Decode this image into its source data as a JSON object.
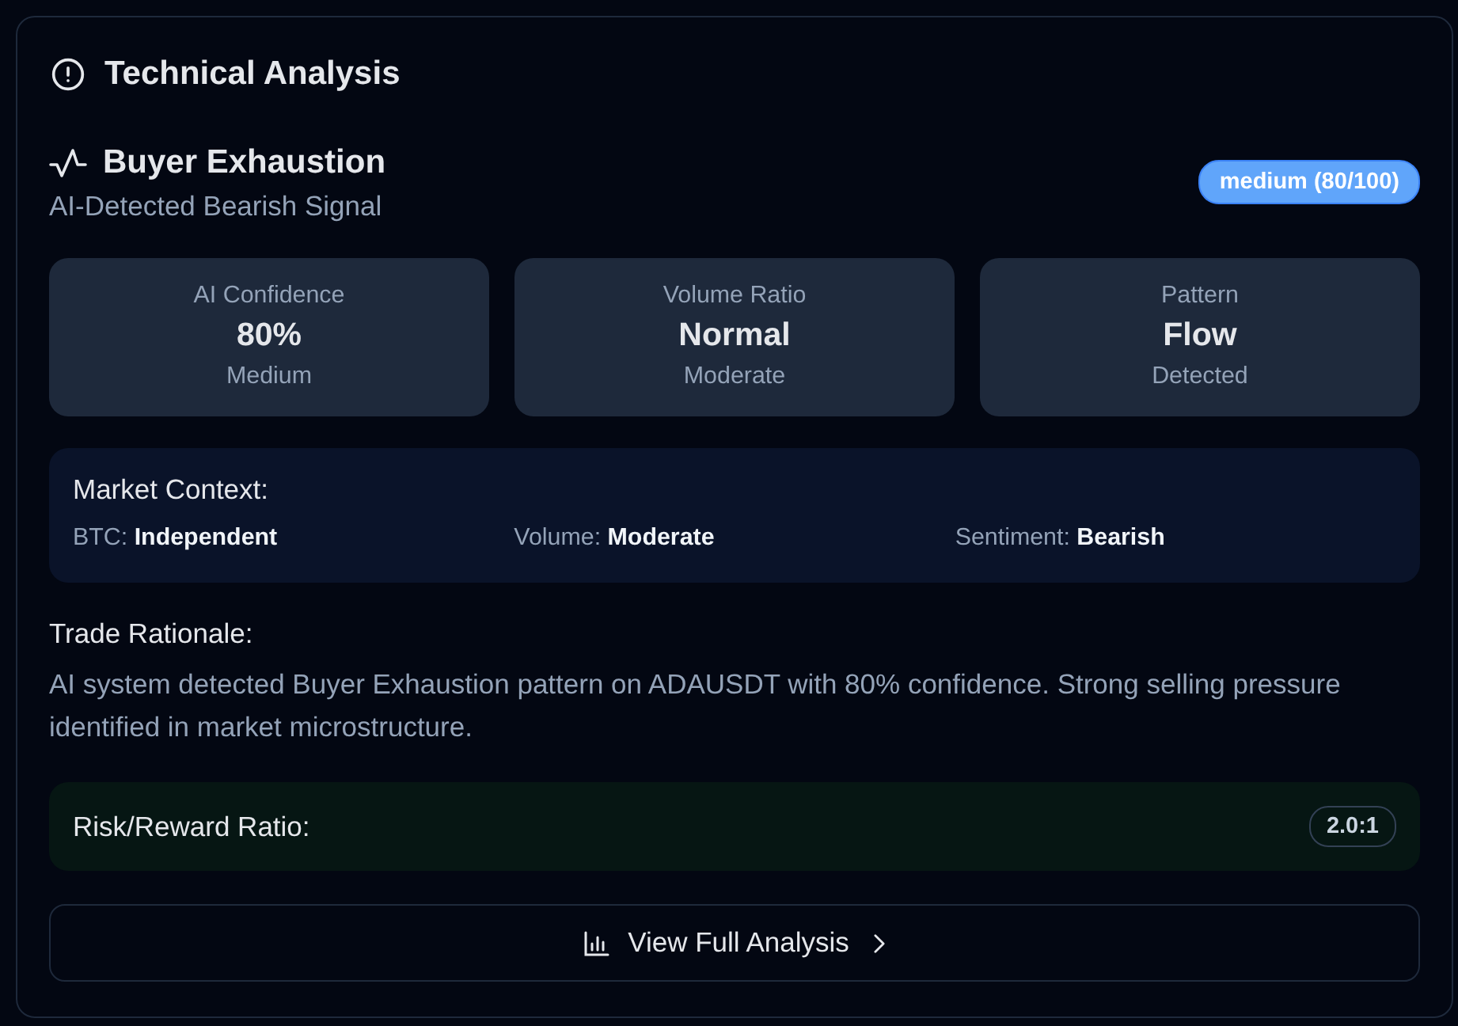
{
  "header": {
    "title": "Technical Analysis"
  },
  "signal": {
    "title": "Buyer Exhaustion",
    "subtitle": "AI-Detected Bearish Signal",
    "badge": "medium (80/100)"
  },
  "stats": [
    {
      "label": "AI Confidence",
      "value": "80%",
      "note": "Medium"
    },
    {
      "label": "Volume Ratio",
      "value": "Normal",
      "note": "Moderate"
    },
    {
      "label": "Pattern",
      "value": "Flow",
      "note": "Detected"
    }
  ],
  "market_context": {
    "title": "Market Context:",
    "items": [
      "BTC: **Independent**",
      "Volume: **Moderate**",
      "Sentiment: **Bearish**"
    ]
  },
  "rationale": {
    "title": "Trade Rationale:",
    "text": "AI system detected Buyer Exhaustion pattern on ADAUSDT with 80% confidence. Strong selling pressure identified in market microstructure."
  },
  "risk_reward": {
    "label": "Risk/Reward Ratio:",
    "value": "2.0:1"
  },
  "action": {
    "label": "View Full Analysis"
  }
}
